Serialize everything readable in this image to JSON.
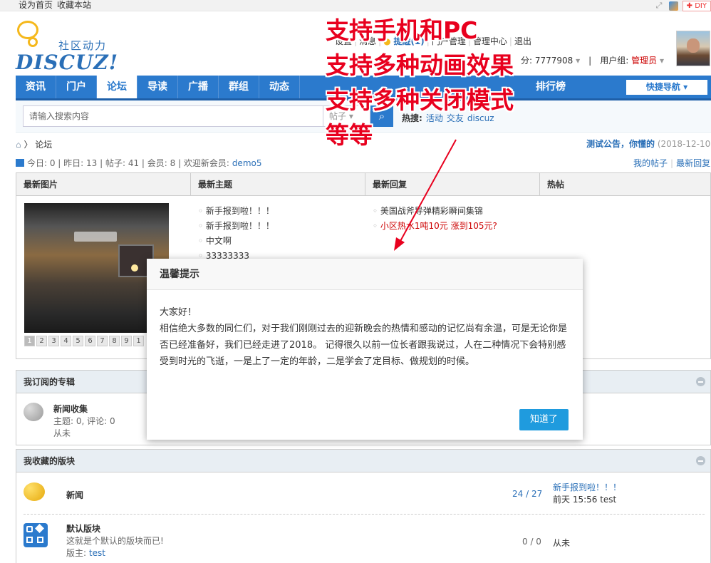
{
  "topbar": {
    "links": [
      "设为首页",
      "收藏本站"
    ],
    "diy": "DIY"
  },
  "logo": {
    "cn": "社区动力",
    "en": "DISCUZ!"
  },
  "userbar": {
    "items": [
      "设置",
      "消息"
    ],
    "remind": "提醒(1)",
    "admin": [
      "门户管理",
      "管理中心",
      "退出"
    ],
    "credits": "分: 7777908",
    "group_label": "用户组:",
    "group": "管理员"
  },
  "nav": {
    "items": [
      "资讯",
      "门户",
      "论坛",
      "导读",
      "广播",
      "群组",
      "动态"
    ],
    "active": "论坛",
    "rank": "排行榜",
    "quick": "快捷导航 ▾"
  },
  "search": {
    "placeholder": "请输入搜索内容",
    "type": "帖子",
    "hot_label": "热搜:",
    "hot": [
      "活动",
      "交友",
      "discuz"
    ]
  },
  "crumb": {
    "current": "论坛"
  },
  "announce": {
    "title": "测试公告，你懂的",
    "date": "(2018-12-10)"
  },
  "stats": {
    "text": "今日: 0 | 昨日: 13 | 帖子: 41 | 会员: 8 | 欢迎新会员:",
    "new_member": "demo5"
  },
  "mylinks": [
    "我的帖子",
    "最新回复"
  ],
  "portal": {
    "headers": [
      "最新图片",
      "最新主题",
      "最新回复",
      "热帖"
    ],
    "pager": [
      "1",
      "2",
      "3",
      "4",
      "5",
      "6",
      "7",
      "8",
      "9",
      "1"
    ],
    "topics": [
      "新手报到啦！！！",
      "新手报到啦！！！",
      "中文啊",
      "33333333"
    ],
    "replies": [
      "美国战斧导弹精彩瞬间集锦",
      "小区热水1吨10元 涨到105元?"
    ]
  },
  "subscribed": {
    "title": "我订阅的专辑",
    "item": {
      "name": "新闻收集",
      "meta": "主题: 0, 评论: 0",
      "last": "从未"
    }
  },
  "favorites": {
    "title": "我收藏的版块",
    "forums": [
      {
        "name": "新闻",
        "count": "24 / 27",
        "last_title": "新手报到啦！！！",
        "last_meta": "前天 15:56 test"
      },
      {
        "name": "默认版块",
        "desc": "这就是个默认的版块而已!",
        "mod_label": "版主:",
        "mod": "test",
        "count": "0 / 0",
        "last_title": "从未"
      }
    ]
  },
  "annotation": [
    "支持手机和PC",
    "支持多种动画效果",
    "支持多种关闭模式",
    "等等"
  ],
  "modal": {
    "title": "温馨提示",
    "greeting": "大家好！",
    "body": "相信绝大多数的同仁们，对于我们刚刚过去的迎新晚会的热情和感动的记忆尚有余温，可是无论你是否已经准备好，我们已经走进了2018。 记得很久以前一位长者跟我说过，人在二种情况下会特别感受到时光的飞逝，一是上了一定的年龄，二是学会了定目标、做规划的时候。",
    "button": "知道了"
  },
  "colors": {
    "brand": "#2b7acd",
    "annotation": "#e8001e",
    "button": "#1f9bde"
  }
}
